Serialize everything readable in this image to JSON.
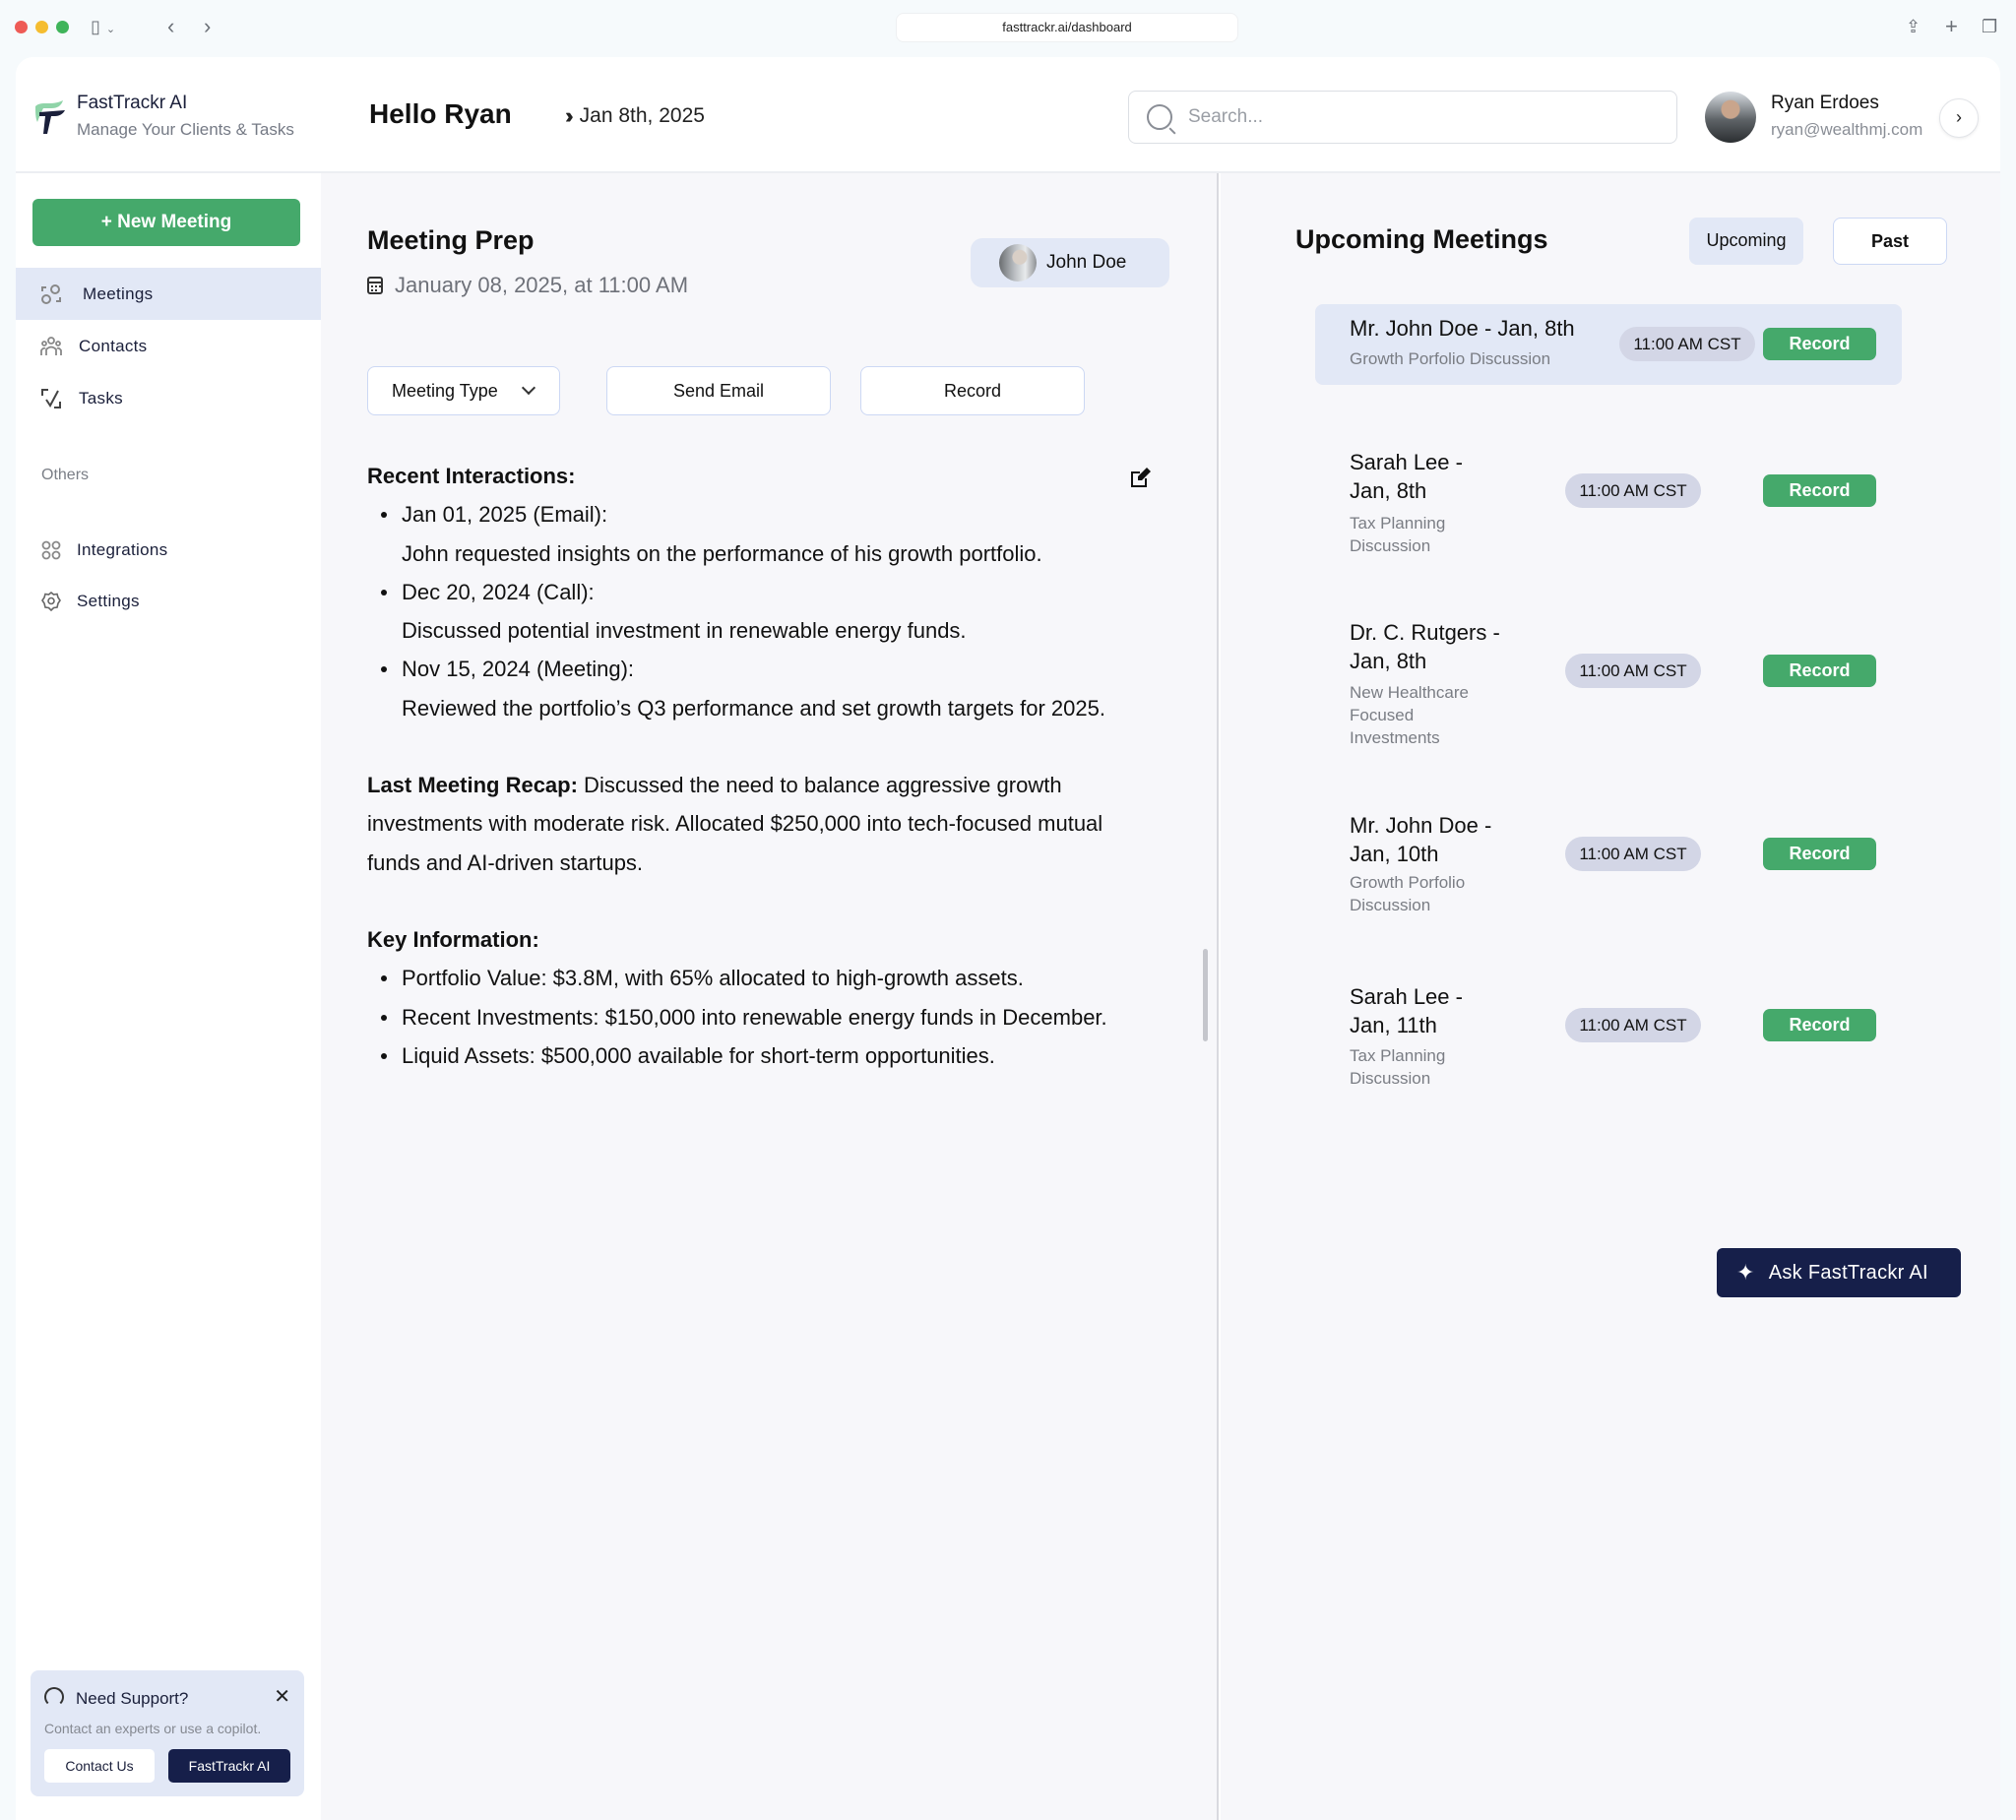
{
  "browser": {
    "url": "fasttrackr.ai/dashboard"
  },
  "header": {
    "brand_name": "FastTrackr AI",
    "brand_tagline": "Manage Your Clients & Tasks",
    "greeting": "Hello Ryan",
    "current_date": "Jan 8th, 2025",
    "search_placeholder": "Search...",
    "search_value": "",
    "user": {
      "name": "Ryan Erdoes",
      "email": "ryan@wealthmj.com"
    }
  },
  "sidebar": {
    "new_meeting_label": "+ New Meeting",
    "items": [
      {
        "label": "Meetings",
        "icon": "meetings-icon",
        "active": true
      },
      {
        "label": "Contacts",
        "icon": "contacts-icon",
        "active": false
      },
      {
        "label": "Tasks",
        "icon": "tasks-icon",
        "active": false
      }
    ],
    "others_heading": "Others",
    "other_items": [
      {
        "label": "Integrations",
        "icon": "integrations-icon"
      },
      {
        "label": "Settings",
        "icon": "gear-icon"
      }
    ],
    "support": {
      "title": "Need Support?",
      "text": "Contact an experts or use a copilot.",
      "contact_label": "Contact Us",
      "ai_label": "FastTrackr AI"
    }
  },
  "meeting_prep": {
    "title": "Meeting Prep",
    "datetime": "January 08, 2025, at 11:00 AM",
    "client_name": "John Doe",
    "meeting_type_label": "Meeting Type",
    "send_email_label": "Send Email",
    "record_label": "Record",
    "recent_interactions_heading": "Recent Interactions:",
    "recent_interactions": [
      {
        "date": "Jan 01, 2025 (Email):",
        "text": "John requested insights on the performance of his growth portfolio."
      },
      {
        "date": "Dec 20, 2024 (Call):",
        "text": "Discussed potential investment in renewable energy funds."
      },
      {
        "date": "Nov 15, 2024 (Meeting):",
        "text": "Reviewed the portfolio’s Q3 performance and set growth targets for 2025."
      }
    ],
    "recap_heading": "Last Meeting Recap:",
    "recap_text": " Discussed the need to balance aggressive growth investments with moderate risk. Allocated $250,000 into tech-focused mutual funds and AI-driven startups.",
    "key_info_heading": "Key Information:",
    "key_info": [
      "Portfolio Value: $3.8M, with 65% allocated to high-growth assets.",
      "Recent Investments: $150,000 into renewable energy funds in December.",
      "Liquid Assets: $500,000 available for short-term opportunities."
    ]
  },
  "upcoming": {
    "title": "Upcoming Meetings",
    "tabs": [
      {
        "label": "Upcoming",
        "active": true
      },
      {
        "label": "Past",
        "active": false
      }
    ],
    "meetings": [
      {
        "title": "Mr. John Doe  - Jan, 8th",
        "subtitle": "Growth Porfolio Discussion",
        "time": "11:00 AM CST",
        "action": "Record",
        "highlighted": true
      },
      {
        "title": "Sarah Lee - Jan, 8th",
        "subtitle": "Tax Planning Discussion",
        "time": "11:00 AM CST",
        "action": "Record",
        "highlighted": false
      },
      {
        "title": "Dr. C. Rutgers - Jan, 8th",
        "subtitle": "New Healthcare Focused Investments",
        "time": "11:00 AM CST",
        "action": "Record",
        "highlighted": false
      },
      {
        "title": "Mr. John Doe - Jan, 10th",
        "subtitle": "Growth Porfolio Discussion",
        "time": "11:00 AM CST",
        "action": "Record",
        "highlighted": false
      },
      {
        "title": "Sarah Lee - Jan, 11th",
        "subtitle": "Tax Planning Discussion",
        "time": "11:00 AM CST",
        "action": "Record",
        "highlighted": false
      }
    ],
    "ask_ai_label": "Ask FastTrackr AI"
  },
  "colors": {
    "accent_green": "#45a96b",
    "navy": "#161f4a",
    "highlight_blue": "#e2e8f6"
  }
}
